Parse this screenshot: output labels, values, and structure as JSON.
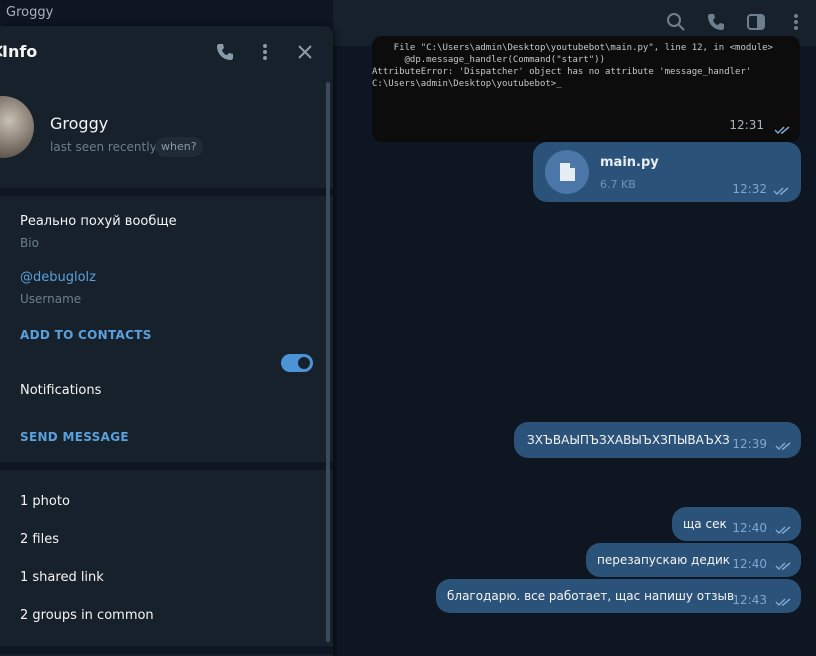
{
  "window": {
    "title": "Groggy"
  },
  "chat_header": {
    "icons": [
      "search-icon",
      "phone-icon",
      "sidebar-icon",
      "more-vertical-icon"
    ]
  },
  "terminal": {
    "lines": [
      "    File \"C:\\Users\\admin\\Desktop\\youtubebot\\main.py\", line 12, in <module>",
      "      @dp.message_handler(Command(\"start\"))",
      "AttributeError: 'Dispatcher' object has no attribute 'message_handler'",
      "",
      "C:\\Users\\admin\\Desktop\\youtubebot>_"
    ],
    "time": "12:31"
  },
  "file_message": {
    "name": "main.py",
    "size": "6.7 KB",
    "time": "12:32"
  },
  "messages": [
    {
      "text": "ЗХЪВАЫПЪЗХАВЫЪХЗПЫВАЪХЗ",
      "time": "12:39"
    },
    {
      "text": "ща сек",
      "time": "12:40"
    },
    {
      "text": "перезапускаю дедик",
      "time": "12:40"
    },
    {
      "text": "благодарю. все работает, щас напишу отзыв",
      "time": "12:43"
    }
  ],
  "info_panel": {
    "title": "Info",
    "name": "Groggy",
    "status": "last seen recently",
    "when_label": "when?",
    "bio": {
      "value": "Реально похуй вообще",
      "label": "Bio"
    },
    "username": {
      "value": "@debuglolz",
      "label": "Username"
    },
    "add_to_contacts": "ADD TO CONTACTS",
    "notifications": {
      "label": "Notifications",
      "enabled": true
    },
    "send_message": "SEND MESSAGE",
    "media": [
      {
        "label": "1 photo"
      },
      {
        "label": "2 files"
      },
      {
        "label": "1 shared link"
      },
      {
        "label": "2 groups in common"
      }
    ]
  },
  "colors": {
    "accent": "#5aa0dc",
    "bubble": "#2b5278",
    "panel": "#17212b",
    "background": "#0e1621"
  }
}
